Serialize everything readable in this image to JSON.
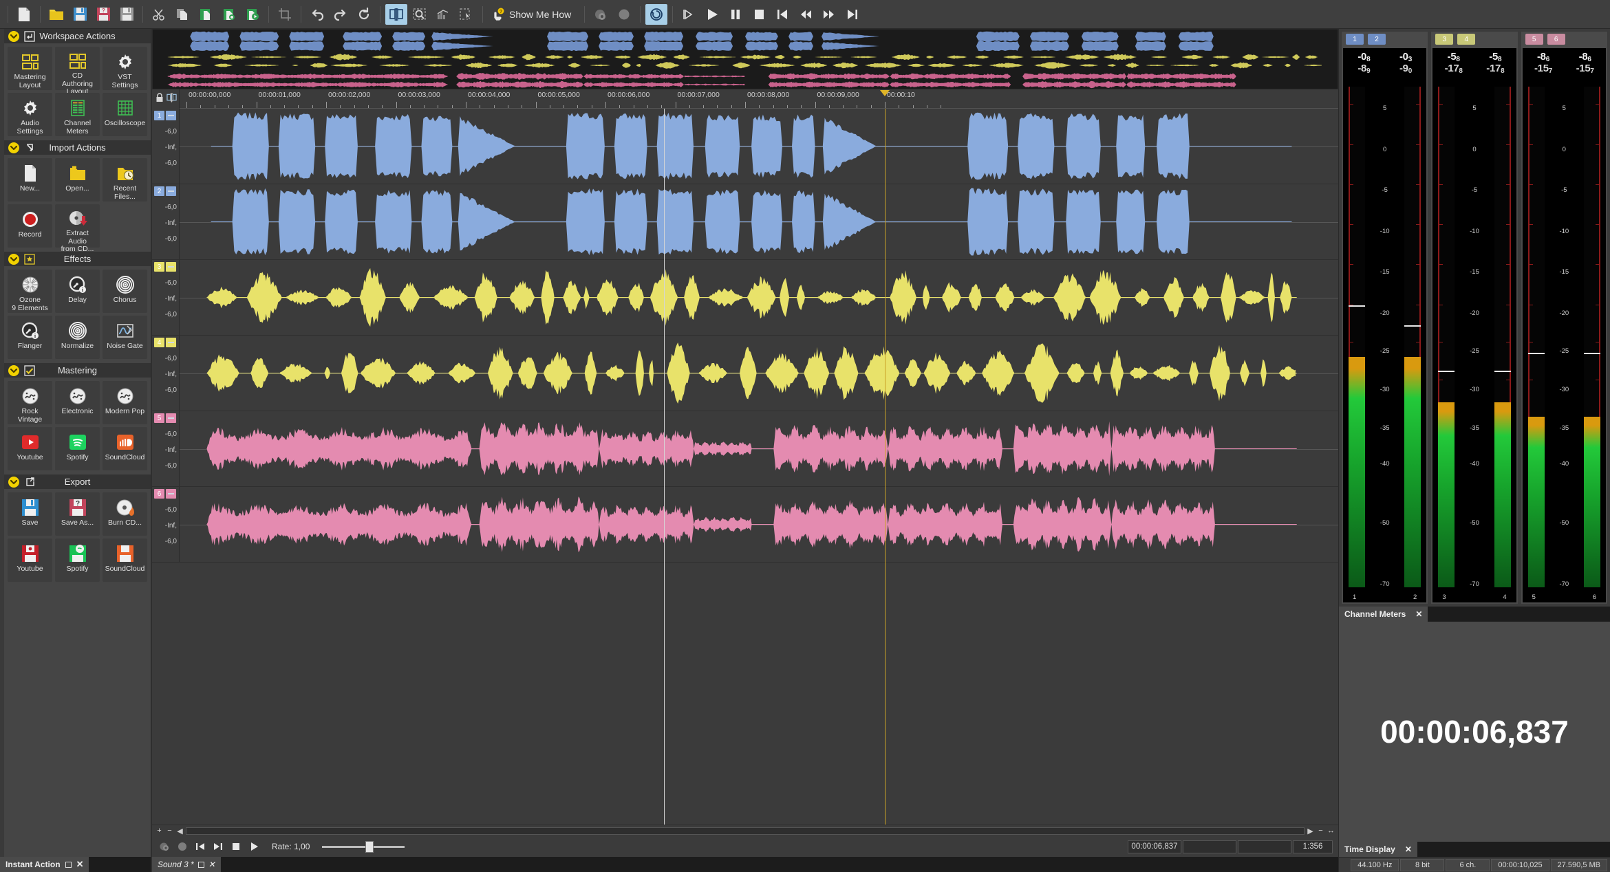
{
  "toolbar": {
    "items": [
      {
        "name": "new-file-icon",
        "label": "New",
        "active": false
      },
      {
        "name": "open-folder-icon",
        "label": "Open",
        "active": false
      },
      {
        "name": "save-icon",
        "label": "Save",
        "active": false
      },
      {
        "name": "save-as-icon",
        "label": "Save As",
        "active": false
      },
      {
        "name": "save-all-icon",
        "label": "Save All",
        "active": false
      },
      {
        "name": "cut-icon",
        "label": "Cut",
        "active": false
      },
      {
        "name": "copy-icon",
        "label": "Copy",
        "active": false
      },
      {
        "name": "paste-icon",
        "label": "Paste",
        "active": false
      },
      {
        "name": "paste-special-icon",
        "label": "Paste Special",
        "active": false
      },
      {
        "name": "mix-paste-icon",
        "label": "Mix Paste",
        "active": false
      },
      {
        "name": "trim-crop-icon",
        "label": "Trim/Crop",
        "active": false
      },
      {
        "name": "undo-icon",
        "label": "Undo",
        "active": false
      },
      {
        "name": "redo-icon",
        "label": "Redo",
        "active": false
      },
      {
        "name": "restore-icon",
        "label": "Restore",
        "active": false
      },
      {
        "name": "edit-tool-icon",
        "label": "Edit Tool",
        "active": true
      },
      {
        "name": "magnify-tool-icon",
        "label": "Magnify Tool",
        "active": false
      },
      {
        "name": "envelope-tool-icon",
        "label": "Envelope Tool",
        "active": false
      },
      {
        "name": "select-tool-icon",
        "label": "Select Tool",
        "active": false
      }
    ],
    "show_me_how": "Show Me How",
    "transport": [
      {
        "name": "record-arm-icon",
        "label": "Record Arm"
      },
      {
        "name": "record-icon",
        "label": "Record"
      },
      {
        "name": "loop-playback-icon",
        "label": "Loop Playback",
        "active": true
      },
      {
        "name": "play-selection-icon",
        "label": "Play Selection"
      },
      {
        "name": "play-icon",
        "label": "Play"
      },
      {
        "name": "pause-icon",
        "label": "Pause"
      },
      {
        "name": "stop-icon",
        "label": "Stop"
      },
      {
        "name": "go-to-start-icon",
        "label": "Go To Start"
      },
      {
        "name": "rewind-icon",
        "label": "Rewind"
      },
      {
        "name": "fast-forward-icon",
        "label": "Fast Forward"
      },
      {
        "name": "go-to-end-icon",
        "label": "Go To End"
      }
    ]
  },
  "sidebar": {
    "sections": [
      {
        "title": "Workspace Actions",
        "icon": "enter-arrow-icon",
        "tiles": [
          {
            "label": "Mastering\nLayout",
            "icon": "layout-grid-icon"
          },
          {
            "label": "CD Authoring\nLayout",
            "icon": "layout-grid-icon"
          },
          {
            "label": "VST Settings",
            "icon": "gear-icon"
          },
          {
            "label": "Audio\nSettings",
            "icon": "gear-icon"
          },
          {
            "label": "Channel\nMeters",
            "icon": "channel-meters-icon"
          },
          {
            "label": "Oscilloscope",
            "icon": "oscilloscope-icon"
          }
        ]
      },
      {
        "title": "Import Actions",
        "icon": "import-arrow-icon",
        "tiles": [
          {
            "label": "New...",
            "icon": "page-icon"
          },
          {
            "label": "Open...",
            "icon": "folder-icon"
          },
          {
            "label": "Recent\nFiles...",
            "icon": "recent-files-icon"
          },
          {
            "label": "Record",
            "icon": "record-circle-icon"
          },
          {
            "label": "Extract Audio\nfrom CD...",
            "icon": "cd-extract-icon"
          }
        ]
      },
      {
        "title": "Effects",
        "icon": "effects-star-icon",
        "tiles": [
          {
            "label": "Ozone\n9 Elements",
            "icon": "ozone-icon"
          },
          {
            "label": "Delay",
            "icon": "knob-icon"
          },
          {
            "label": "Chorus",
            "icon": "chorus-icon"
          },
          {
            "label": "Flanger",
            "icon": "knob-icon"
          },
          {
            "label": "Normalize",
            "icon": "normalize-icon"
          },
          {
            "label": "Noise Gate",
            "icon": "noise-gate-icon"
          }
        ]
      },
      {
        "title": "Mastering",
        "icon": "checkbox-icon",
        "tiles": [
          {
            "label": "Rock Vintage",
            "icon": "vinyl-icon"
          },
          {
            "label": "Electronic",
            "icon": "vinyl-icon"
          },
          {
            "label": "Modern Pop",
            "icon": "vinyl-icon"
          },
          {
            "label": "Youtube",
            "icon": "youtube-icon"
          },
          {
            "label": "Spotify",
            "icon": "spotify-icon"
          },
          {
            "label": "SoundCloud",
            "icon": "soundcloud-icon"
          }
        ]
      },
      {
        "title": "Export",
        "icon": "export-arrow-icon",
        "tiles": [
          {
            "label": "Save",
            "icon": "save-blue-icon"
          },
          {
            "label": "Save As...",
            "icon": "save-red-icon"
          },
          {
            "label": "Burn CD...",
            "icon": "burn-cd-icon"
          },
          {
            "label": "Youtube",
            "icon": "save-youtube-icon"
          },
          {
            "label": "Spotify",
            "icon": "save-spotify-icon"
          },
          {
            "label": "SoundCloud",
            "icon": "save-soundcloud-icon"
          }
        ]
      }
    ],
    "footer_tab": "Instant Action"
  },
  "ruler": {
    "labels": [
      "00:00:00,000",
      "00:00:01,000",
      "00:00:02,000",
      "00:00:03,000",
      "00:00:04,000",
      "00:00:05,000",
      "00:00:06,000",
      "00:00:07,000",
      "00:00:08,000",
      "00:00:09,000",
      "00:00:10"
    ],
    "lock_icon": "lock-icon",
    "snap_icon": "edit-tool-icon"
  },
  "tracks": [
    {
      "number": "1",
      "color": "#8aabdd",
      "scale": [
        "-6,0",
        "-Inf,",
        "-6,0"
      ],
      "waveform": "blue-a"
    },
    {
      "number": "2",
      "color": "#8aabdd",
      "scale": [
        "-6,0",
        "-Inf,",
        "-6,0"
      ],
      "waveform": "blue-b"
    },
    {
      "number": "3",
      "color": "#e8e26a",
      "scale": [
        "-6,0",
        "-Inf,",
        "-6,0"
      ],
      "waveform": "yellow-a"
    },
    {
      "number": "4",
      "color": "#e8e26a",
      "scale": [
        "-6,0",
        "-Inf,",
        "-6,0"
      ],
      "waveform": "yellow-b"
    },
    {
      "number": "5",
      "color": "#e48bb0",
      "scale": [
        "-6,0",
        "-Inf,",
        "-6,0"
      ],
      "waveform": "pink-a"
    },
    {
      "number": "6",
      "color": "#e48bb0",
      "scale": [
        "-6,0",
        "-Inf,",
        "-6,0"
      ],
      "waveform": "pink-b"
    }
  ],
  "transport_bar": {
    "rate_label": "Rate: 1,00",
    "position": "00:00:06,837",
    "field2": "",
    "field3": "",
    "ratio": "1:356"
  },
  "document_tab": "Sound 3 *",
  "meters": {
    "panel_tab": "Channel Meters",
    "groups": [
      {
        "chips": [
          "1",
          "2"
        ],
        "chip_color": "#6f8ec4",
        "peaks_top": [
          {
            "main": "-0",
            "sub": "8"
          },
          {
            "main": "-0",
            "sub": "3"
          }
        ],
        "peaks_bottom": [
          {
            "main": "-8",
            "sub": "9"
          },
          {
            "main": "-9",
            "sub": "0"
          }
        ],
        "levels": [
          0.46,
          0.46
        ],
        "peak_hold": [
          0.56,
          0.52
        ],
        "channel_numbers": [
          "1",
          "2"
        ]
      },
      {
        "chips": [
          "3",
          "4"
        ],
        "chip_color": "#c8c878",
        "peaks_top": [
          {
            "main": "-5",
            "sub": "8"
          },
          {
            "main": "-5",
            "sub": "8"
          }
        ],
        "peaks_bottom": [
          {
            "main": "-17",
            "sub": "8"
          },
          {
            "main": "-17",
            "sub": "8"
          }
        ],
        "levels": [
          0.37,
          0.37
        ],
        "peak_hold": [
          0.43,
          0.43
        ],
        "channel_numbers": [
          "3",
          "4"
        ]
      },
      {
        "chips": [
          "5",
          "6"
        ],
        "chip_color": "#c98ca0",
        "peaks_top": [
          {
            "main": "-8",
            "sub": "6"
          },
          {
            "main": "-8",
            "sub": "6"
          }
        ],
        "peaks_bottom": [
          {
            "main": "-15",
            "sub": "7"
          },
          {
            "main": "-15",
            "sub": "7"
          }
        ],
        "levels": [
          0.34,
          0.34
        ],
        "peak_hold": [
          0.465,
          0.465
        ],
        "channel_numbers": [
          "5",
          "6"
        ]
      }
    ],
    "scale_marks": [
      "5",
      "0",
      "-5",
      "-10",
      "-15",
      "-20",
      "-25",
      "-30",
      "-35",
      "-40",
      "-50",
      "-70"
    ]
  },
  "time_display": {
    "panel_tab": "Time Display",
    "value": "00:00:06,837"
  },
  "statusbar": {
    "cells": [
      "44.100 Hz",
      "8 bit",
      "6 ch.",
      "00:00:10,025",
      "27.590,5 MB"
    ]
  }
}
